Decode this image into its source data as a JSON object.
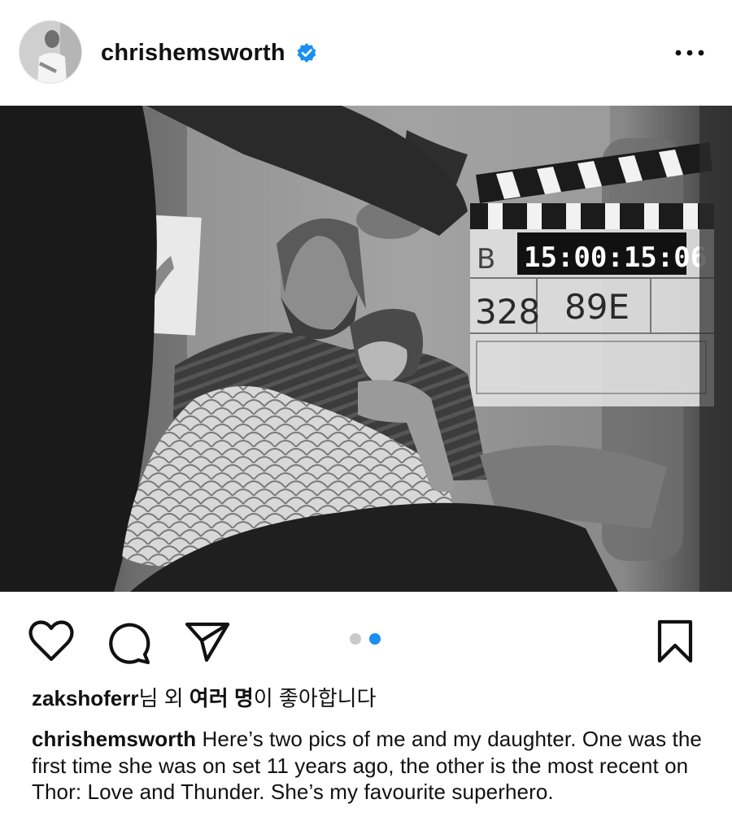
{
  "post": {
    "username": "chrishemsworth",
    "verified": true,
    "more_icon": "more-horizontal-icon",
    "photo_alt": "",
    "carousel": {
      "count": 2,
      "active_index": 1,
      "active_color": "#1b8ef2",
      "inactive_color": "#c9c9c9"
    }
  },
  "actions": {
    "like_icon": "heart-icon",
    "comment_icon": "comment-icon",
    "share_icon": "send-icon",
    "save_icon": "bookmark-icon"
  },
  "likes": {
    "user": "zakshoferr",
    "text_1": "님 외 ",
    "others": "여러 명",
    "text_2": "이 좋아합니다"
  },
  "caption": {
    "username": "chrishemsworth",
    "text": " Here’s two pics of me and my daughter. One was the first time she was on set 11 years ago, the other is the most recent on Thor: Love and Thunder. She’s my favourite superhero."
  },
  "clapperboard": {
    "timecode": "15:00:15:06",
    "scene": "328",
    "take": "89E"
  }
}
